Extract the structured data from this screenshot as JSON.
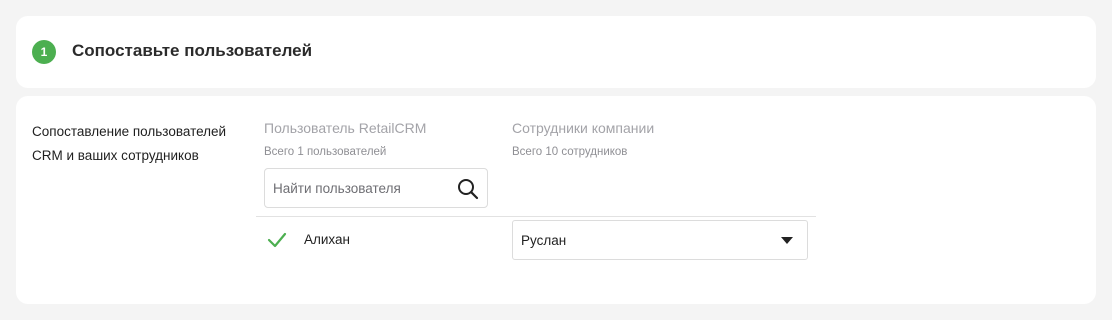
{
  "step": {
    "number": "1",
    "title": "Сопоставьте пользователей",
    "badge_color": "#4caf50"
  },
  "mapping": {
    "description": "Сопоставление пользователей CRM и ваших сотрудников",
    "left_column": {
      "header": "Пользователь RetailCRM",
      "count": "Всего 1 пользователей"
    },
    "right_column": {
      "header": "Сотрудники компании",
      "count": "Всего 10 сотрудников"
    },
    "search": {
      "placeholder": "Найти пользователя",
      "icon": "search-icon"
    },
    "rows": [
      {
        "user": "Алихан",
        "matched": true,
        "employee": "Руслан"
      }
    ]
  }
}
